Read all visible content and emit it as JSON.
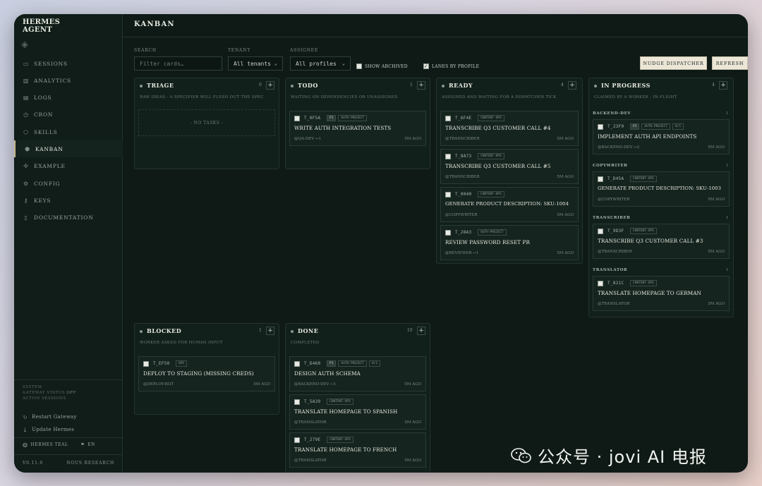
{
  "app": {
    "brand": "HERMES\nAGENT",
    "page_title": "KANBAN"
  },
  "sidebar": {
    "items": [
      {
        "label": "SESSIONS",
        "icon": "chat-icon"
      },
      {
        "label": "ANALYTICS",
        "icon": "chart-icon"
      },
      {
        "label": "LOGS",
        "icon": "file-icon"
      },
      {
        "label": "CRON",
        "icon": "clock-icon"
      },
      {
        "label": "SKILLS",
        "icon": "cube-icon"
      },
      {
        "label": "KANBAN",
        "icon": "package-icon",
        "active": true
      },
      {
        "label": "EXAMPLE",
        "icon": "puzzle-icon"
      },
      {
        "label": "CONFIG",
        "icon": "gear-icon"
      },
      {
        "label": "KEYS",
        "icon": "key-icon"
      },
      {
        "label": "DOCUMENTATION",
        "icon": "book-icon"
      }
    ],
    "system": {
      "label": "SYSTEM",
      "gateway_label": "GATEWAY STATUS",
      "gateway_value": "OFF",
      "line3": "ACTIVE SESSIONS"
    },
    "restart_label": "Restart Gateway",
    "update_label": "Update Hermes",
    "theme_label": "HERMES TEAL",
    "lang_label": "EN",
    "version": "V0.11.0",
    "org": "NOUS RESEARCH"
  },
  "filters": {
    "search_label": "SEARCH",
    "search_placeholder": "Filter cards…",
    "tenant_label": "TENANT",
    "tenant_value": "All tenants",
    "assignee_label": "ASSIGNEE",
    "assignee_value": "All profiles",
    "show_archived": "SHOW ARCHIVED",
    "lanes_by_profile": "LANES BY PROFILE",
    "nudge_button": "NUDGE DISPATCHER",
    "refresh_button": "REFRESH"
  },
  "columns": {
    "triage": {
      "title": "TRIAGE",
      "count": "0",
      "desc": "RAW IDEAS - A SPECIFIER WILL FLESH OUT THE SPEC",
      "empty": "- NO TASKS -"
    },
    "todo": {
      "title": "TODO",
      "count": "1",
      "desc": "WAITING ON DEPENDENCIES OR UNASSIGNED",
      "cards": [
        {
          "id": "T_0F5A",
          "badges": [
            "P1",
            "AUTH-PROJECT"
          ],
          "title": "WRITE AUTH INTEGRATION TESTS",
          "assignee": "@QA-DEV   ↔1",
          "age": "5M AGO"
        }
      ]
    },
    "ready": {
      "title": "READY",
      "count": "4",
      "desc": "ASSIGNED AND WAITING FOR A DISPATCHER TICK",
      "cards": [
        {
          "id": "T_6F4E",
          "badges": [
            "CONTENT-OPS"
          ],
          "title": "TRANSCRIBE Q3 CUSTOMER CALL #4",
          "assignee": "@TRANSCRIBER",
          "age": "5M AGO"
        },
        {
          "id": "T_8A73",
          "badges": [
            "CONTENT-OPS"
          ],
          "title": "TRANSCRIBE Q3 CUSTOMER CALL #5",
          "assignee": "@TRANSCRIBER",
          "age": "5M AGO"
        },
        {
          "id": "T_0040",
          "badges": [
            "CONTENT-OPS"
          ],
          "title": "GENERATE PRODUCT DESCRIPTION: SKU-1004",
          "assignee": "@COPYWRITER",
          "age": "5M AGO"
        },
        {
          "id": "T_28A3",
          "badges": [
            "AUTH-PROJECT"
          ],
          "title": "REVIEW PASSWORD RESET PR",
          "assignee": "@REVIEWER   ↔1",
          "age": "5M AGO"
        }
      ]
    },
    "in_progress": {
      "title": "IN PROGRESS",
      "count": "4",
      "desc": "CLAIMED BY A WORKER - IN-FLIGHT",
      "lanes": [
        {
          "name": "BACKEND-DEV",
          "count": "1",
          "card": {
            "id": "T_23F0",
            "badges": [
              "P2",
              "AUTH-PROJECT",
              "0/1"
            ],
            "title": "IMPLEMENT AUTH API ENDPOINTS",
            "assignee": "@BACKEND-DEV   ↔2",
            "age": "5M AGO"
          }
        },
        {
          "name": "COPYWRITER",
          "count": "1",
          "card": {
            "id": "T_D45A",
            "badges": [
              "CONTENT-OPS"
            ],
            "title": "GENERATE PRODUCT DESCRIPTION: SKU-1003",
            "assignee": "@COPYWRITER",
            "age": "5M AGO"
          }
        },
        {
          "name": "TRANSCRIBER",
          "count": "1",
          "card": {
            "id": "T_9D3F",
            "badges": [
              "CONTENT-OPS"
            ],
            "title": "TRANSCRIBE Q3 CUSTOMER CALL #3",
            "assignee": "@TRANSCRIBER",
            "age": "5M AGO"
          }
        },
        {
          "name": "TRANSLATOR",
          "count": "1",
          "card": {
            "id": "T_821C",
            "badges": [
              "CONTENT-OPS"
            ],
            "title": "TRANSLATE HOMEPAGE TO GERMAN",
            "assignee": "@TRANSLATOR",
            "age": "5M AGO"
          }
        }
      ]
    },
    "blocked": {
      "title": "BLOCKED",
      "count": "1",
      "desc": "WORKER ASKED FOR HUMAN INPUT",
      "cards": [
        {
          "id": "T_EF50",
          "badges": [
            "OPS"
          ],
          "title": "DEPLOY TO STAGING (MISSING CREDS)",
          "assignee": "@DEPLOY-BOT",
          "age": "5M AGO"
        }
      ]
    },
    "done": {
      "title": "DONE",
      "count": "10",
      "desc": "COMPLETED",
      "cards": [
        {
          "id": "T_D460",
          "badges": [
            "P1",
            "AUTH-PROJECT",
            "0/1"
          ],
          "title": "DESIGN AUTH SCHEMA",
          "assignee": "@BACKEND-DEV   ↔1",
          "age": "5M AGO"
        },
        {
          "id": "T_5A39",
          "badges": [
            "CONTENT-OPS"
          ],
          "title": "TRANSLATE HOMEPAGE TO SPANISH",
          "assignee": "@TRANSLATOR",
          "age": "5M AGO"
        },
        {
          "id": "T_279E",
          "badges": [
            "CONTENT-OPS"
          ],
          "title": "TRANSLATE HOMEPAGE TO FRENCH",
          "assignee": "@TRANSLATOR",
          "age": "5M AGO"
        }
      ]
    }
  },
  "watermark": {
    "text": "公众号 · jovi AI 电报"
  }
}
